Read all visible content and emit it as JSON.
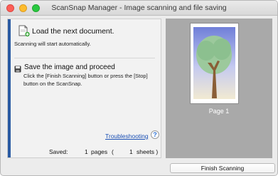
{
  "window": {
    "title": "ScanSnap Manager - Image scanning and file saving"
  },
  "steps": {
    "load": {
      "title": "Load the next document.",
      "description": "Scanning will start automatically.",
      "icon": "load-document-icon"
    },
    "save": {
      "title": "Save the image and proceed",
      "description": "Click the [Finish Scanning] button or press the [Stop] button on the ScanSnap.",
      "icon": "save-disk-icon"
    }
  },
  "links": {
    "troubleshooting": "Troubleshooting",
    "help": "?"
  },
  "summary": {
    "saved_label": "Saved:",
    "pages_count": "1",
    "pages_unit": "pages",
    "open_paren": "(",
    "sheets_count": "1",
    "sheets_unit": "sheets )"
  },
  "preview": {
    "page_label": "Page 1"
  },
  "buttons": {
    "finish": "Finish Scanning"
  },
  "colors": {
    "accent": "#2b5ba3",
    "link": "#1a4fb4",
    "preview_bg": "#a9a9a9"
  }
}
